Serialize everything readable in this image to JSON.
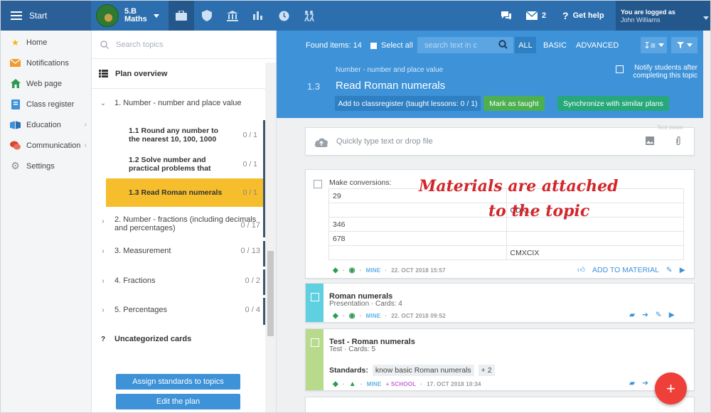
{
  "topbar": {
    "start_label": "Start",
    "class_line1": "5.B",
    "class_line2": "Maths",
    "chat_badge": "2",
    "help_label": "Get help",
    "logged_as": "You are logged as",
    "user_name": "John Williams"
  },
  "sidebar": {
    "items": [
      {
        "label": "Home",
        "icon": "star-icon"
      },
      {
        "label": "Notifications",
        "icon": "envelope-icon"
      },
      {
        "label": "Web page",
        "icon": "home-icon"
      },
      {
        "label": "Class register",
        "icon": "book-icon"
      },
      {
        "label": "Education",
        "icon": "education-icon"
      },
      {
        "label": "Communication",
        "icon": "chat-icon"
      },
      {
        "label": "Settings",
        "icon": "gear-icon"
      }
    ]
  },
  "topics": {
    "search_placeholder": "Search topics",
    "plan_overview": "Plan overview",
    "groups": [
      {
        "label": "1. Number - number and place value",
        "count": ""
      },
      {
        "label": "2. Number - fractions (including decimals and percentages)",
        "count": "0 / 17"
      },
      {
        "label": "3. Measurement",
        "count": "0 / 13"
      },
      {
        "label": "4. Fractions",
        "count": "0 / 2"
      },
      {
        "label": "5. Percentages",
        "count": "0 / 4"
      }
    ],
    "subtopics": [
      {
        "label": "1.1 Round any number to the nearest 10, 100, 1000",
        "count": "0 / 1"
      },
      {
        "label": "1.2 Solve number and practical problems that",
        "count": "0 / 1"
      },
      {
        "label": "1.3 Read Roman numerals",
        "count": "0 / 1"
      }
    ],
    "uncategorized": "Uncategorized cards",
    "assign_button": "Assign standards to topics",
    "edit_button": "Edit the plan"
  },
  "toolbar": {
    "found_items": "Found items: 14",
    "select_all": "Select all",
    "search_placeholder": "search text in c",
    "filter_all": "ALL",
    "filter_basic": "BASIC",
    "filter_advanced": "ADVANCED"
  },
  "topic_header": {
    "parent": "Number - number and place value",
    "number": "1.3",
    "title": "Read Roman numerals",
    "notify_label": "Notify students after completing this topic",
    "add_button": "Add to classregister (taught lessons: 0 / 1)",
    "mark_button": "Mark as taught",
    "sync_button": "Synchronize with similar plans"
  },
  "quick": {
    "placeholder": "Quickly type text or drop file",
    "corner_label": "Text zoom"
  },
  "card1": {
    "title": "Make conversions:",
    "rows": [
      [
        "29",
        ""
      ],
      [
        "",
        "CDXL"
      ],
      [
        "346",
        ""
      ],
      [
        "678",
        ""
      ],
      [
        "",
        "CMXCIX"
      ]
    ],
    "meta_mine": "MINE",
    "meta_date": "22. OCT 2018 15:57",
    "add_to_material": "ADD TO MATERIAL"
  },
  "card2": {
    "title": "Roman numerals",
    "subtitle": "Presentation · Cards: 4",
    "meta_mine": "MINE",
    "meta_date": "22. OCT 2018 09:52",
    "accent": "#5fd0e0"
  },
  "card3": {
    "title": "Test - Roman numerals",
    "subtitle": "Test · Cards: 5",
    "standards_label": "Standards:",
    "standard_tag": "know basic Roman numerals",
    "more_tag": "+ 2",
    "meta_mine": "MINE",
    "meta_school": "+ SCHOOL",
    "meta_date": "17. OCT 2018 10:34",
    "accent": "#b7da8c"
  },
  "annotation": {
    "line1": "Materials are attached",
    "line2": "to the topic"
  },
  "colors": {
    "brand": "#2d6fae",
    "header_blue": "#3d92d8",
    "green": "#4caf50",
    "teal": "#26a87a",
    "selected": "#f6bd2c",
    "fab": "#ef3f39"
  }
}
